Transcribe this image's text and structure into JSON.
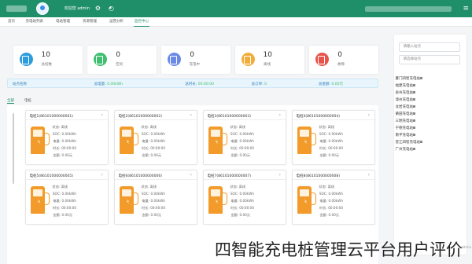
{
  "app": {
    "brand_icon": "grid-menu-icon"
  },
  "topbar": {
    "menu_icon": "≡",
    "icons": [
      "bell-icon",
      "settings-icon",
      "fullscreen-icon"
    ],
    "user_label": "欢迎您 admin"
  },
  "tabs": [
    {
      "label": "首页",
      "active": false
    },
    {
      "label": "充电站列表",
      "active": false
    },
    {
      "label": "电站管理",
      "active": false
    },
    {
      "label": "资源管理",
      "active": false
    },
    {
      "label": "运营分析",
      "active": false
    },
    {
      "label": "监控中心",
      "active": true
    }
  ],
  "sidebar": {
    "search_placeholder": "请输入站点",
    "filter_placeholder": "请选择站点",
    "tree": [
      "厦门四智充电站",
      "福建充电站",
      "泉州充电站",
      "漳州充电站",
      "龙岩充电站",
      "莆田充电站",
      "三明充电站",
      "宁德充电站",
      "南平充电站",
      "晋江四智充电站",
      "广州充电站"
    ]
  },
  "stats": [
    {
      "value": "10",
      "label": "总桩数",
      "color": "#2d9cdb"
    },
    {
      "value": "0",
      "label": "空闲",
      "color": "#3fbf6f"
    },
    {
      "value": "0",
      "label": "充电中",
      "color": "#6a8ae6"
    },
    {
      "value": "10",
      "label": "离线",
      "color": "#f0ad3a"
    },
    {
      "value": "0",
      "label": "故障",
      "color": "#e8534a"
    }
  ],
  "status_bar": [
    {
      "label": "站点名称",
      "value": ""
    },
    {
      "label": "总电量:",
      "value": "0.00kWh"
    },
    {
      "label": "总时长:",
      "value": "00:00:00"
    },
    {
      "label": "总订单:",
      "value": "0"
    },
    {
      "label": "总金额:",
      "value": "0.00元"
    }
  ],
  "sub_tabs": [
    {
      "label": "全部",
      "active": true
    },
    {
      "label": "电桩",
      "active": false
    }
  ],
  "piles": [
    {
      "title": "电桩1(86101000000001)",
      "row": 0,
      "col": 0
    },
    {
      "title": "电桩2(86101000000002)",
      "row": 0,
      "col": 1
    },
    {
      "title": "电桩3(86101000000003)",
      "row": 0,
      "col": 2
    },
    {
      "title": "电桩4(86101000000004)",
      "row": 0,
      "col": 3
    },
    {
      "title": "电桩5(86101000000005)",
      "row": 1,
      "col": 0
    },
    {
      "title": "电桩6(86101000000006)",
      "row": 1,
      "col": 1
    },
    {
      "title": "电桩7(86101000000007)",
      "row": 1,
      "col": 2
    },
    {
      "title": "电桩8(86101000000008)",
      "row": 1,
      "col": 3
    }
  ],
  "pile_fields": {
    "status": "状态: 离线",
    "power": "0.00kWh",
    "time": "00:00:00",
    "amount": "0.00元",
    "gun_label": "枪号:",
    "soc_label": "SOC:",
    "power_label": "电量:",
    "time_label": "时长:",
    "amount_label": "金额:"
  },
  "footer": {
    "corner_text": "admin"
  },
  "watermark": "四智能充电桩管理云平台用户评价"
}
